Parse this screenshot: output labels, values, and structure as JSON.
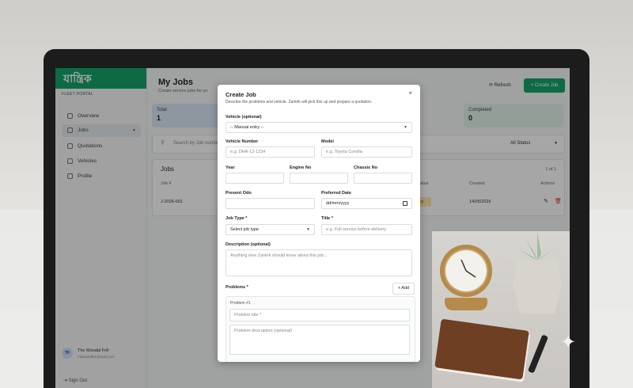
{
  "app": {
    "brand": "যান্ত্রিক",
    "portal_label": "FLEET PORTAL"
  },
  "sidebar": {
    "items": [
      {
        "label": "Overview"
      },
      {
        "label": "Jobs"
      },
      {
        "label": "Quotations"
      },
      {
        "label": "Vehicles"
      },
      {
        "label": "Profile"
      }
    ],
    "user": {
      "initials": "TF",
      "name": "The Mondal FnF",
      "email": "mdwoasif01@mail.com"
    },
    "sign_out": "Sign Out"
  },
  "main": {
    "title": "My Jobs",
    "subtitle": "Create service jobs for yo",
    "refresh": "Refresh",
    "create_job": "+ Create Job",
    "stats": [
      {
        "label": "Total",
        "value": "1"
      },
      {
        "label": "Completed",
        "value": "0"
      }
    ],
    "search_placeholder": "Search by Job number",
    "status_filter": "All Status",
    "table": {
      "title": "Jobs",
      "count": "1 of 1",
      "headers": {
        "job": "Job #",
        "status": "atus",
        "created": "Created",
        "actions": "Actions"
      },
      "row": {
        "job": "J-2026-001",
        "status": "iting",
        "created": "14/05/2026"
      }
    }
  },
  "modal": {
    "title": "Create Job",
    "description": "Describe the problems and vehicle. Zantrik will pick this up and prepare a quotation.",
    "close": "×",
    "vehicle_label": "Vehicle (optional)",
    "vehicle_value": "-- Manual entry --",
    "vehicle_number_label": "Vehicle Number",
    "vehicle_number_placeholder": "e.g. DHA-12-1234",
    "model_label": "Model",
    "model_placeholder": "e.g. Toyota Corolla",
    "year_label": "Year",
    "engine_label": "Engine No",
    "chassis_label": "Chassis No",
    "odo_label": "Present Odo",
    "date_label": "Preferred Date",
    "date_placeholder": "dd/mm/yyyy",
    "job_type_label": "Job Type *",
    "job_type_value": "Select job type",
    "title_label": "Title *",
    "title_placeholder": "e.g. Full service before delivery",
    "desc_label": "Description (optional)",
    "desc_placeholder": "Anything else Zantrik should know about this job...",
    "problems_label": "Problems *",
    "add_label": "+ Add",
    "problem_card_label": "Problem #1",
    "problem_title_placeholder": "Problem title *",
    "problem_desc_placeholder": "Problem description (optional)"
  },
  "colors": {
    "brand": "#14a36b",
    "stat_total": "#dbe7f5",
    "stat_completed": "#e2f3ea"
  },
  "icons": {
    "refresh": "refresh-icon",
    "search": "search-icon",
    "edit": "edit-icon",
    "delete": "trash-icon"
  }
}
